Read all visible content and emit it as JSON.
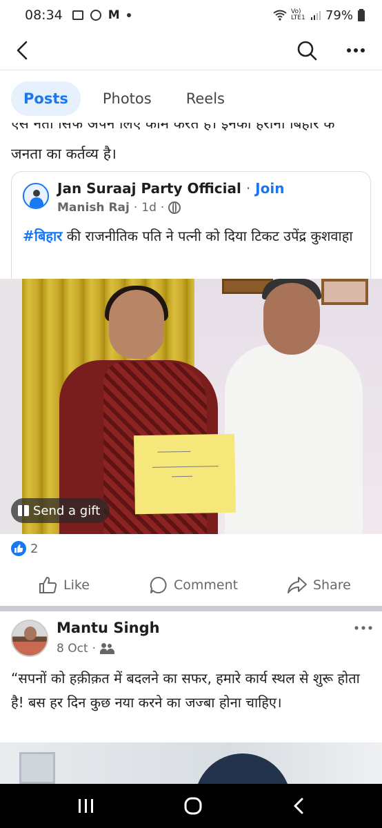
{
  "status_bar": {
    "time": "08:34",
    "network_label": "Vo) LTE1",
    "battery": "79%"
  },
  "header": {
    "back_icon": "back-arrow-icon",
    "search_icon": "search-icon",
    "more_icon": "more-horizontal-icon"
  },
  "tabs": [
    {
      "label": "Posts",
      "active": true
    },
    {
      "label": "Photos",
      "active": false
    },
    {
      "label": "Reels",
      "active": false
    }
  ],
  "post1": {
    "cut_line": "ऐसे नेता सिर्फ अपने लिए काम करते हैं। इनको हराना बिहार के",
    "text_line2": "जनता का कर्तव्य है।",
    "shared": {
      "group_name": "Jan Suraaj Party Official",
      "separator": "·",
      "join_label": "Join",
      "author": "Manish Raj",
      "time": "1d",
      "hashtag": "#बिहार",
      "text": " की राजनीतिक पति ने पत्नी को दिया टिकट उपेंद्र कुशवाहा"
    },
    "gift_label": "Send a gift",
    "reaction_count": "2",
    "actions": {
      "like": "Like",
      "comment": "Comment",
      "share": "Share"
    }
  },
  "post2": {
    "author": "Mantu Singh",
    "date": "8 Oct",
    "text": "“सपनों को हक़ीक़त में बदलने का सफर, हमारे कार्य स्थल से शुरू होता है! बस हर दिन कुछ नया करने का जज्बा होना चाहिए।"
  },
  "colors": {
    "accent": "#1877f2",
    "tab_active_bg": "#e7f0fd",
    "secondary_text": "#65676b",
    "nav_bar": "#000000"
  }
}
